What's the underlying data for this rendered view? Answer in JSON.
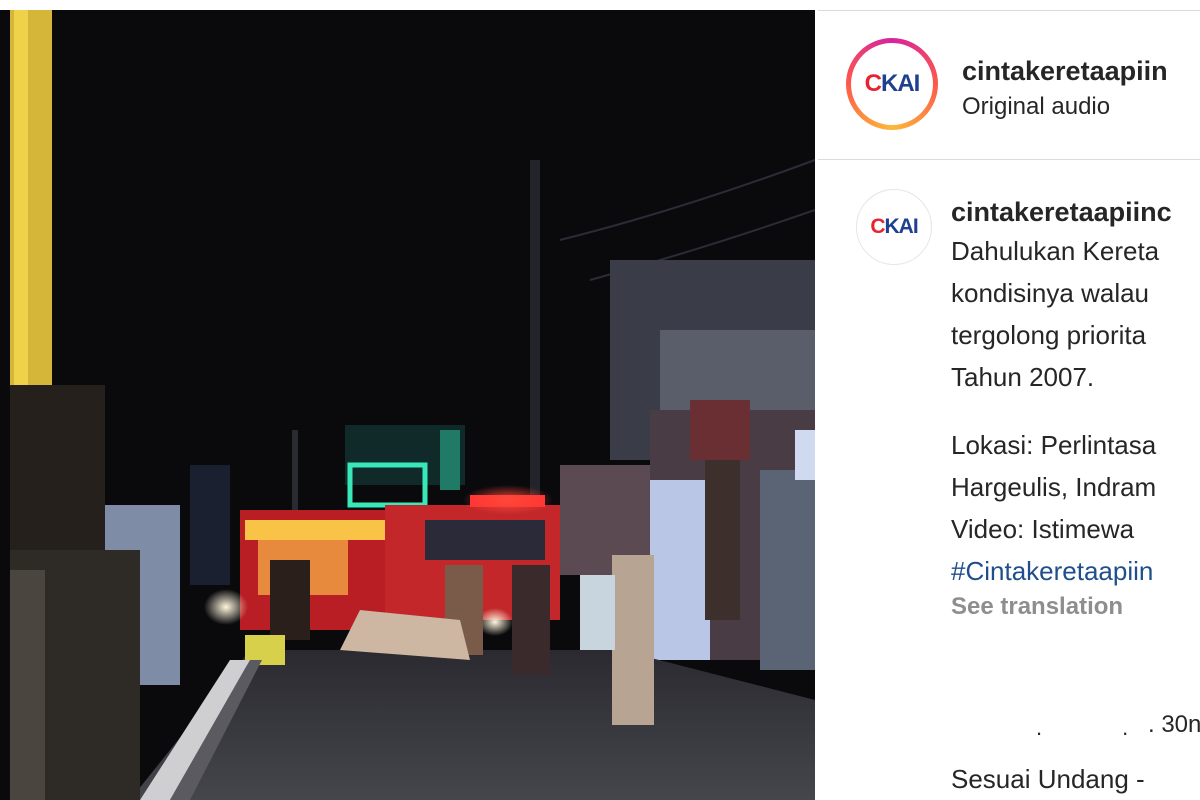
{
  "post": {
    "username": "cintakeretaapiin",
    "audio_label": "Original audio",
    "logo": {
      "c": "C",
      "rest": "KAI"
    }
  },
  "caption": {
    "username": "cintakeretaapiinc",
    "lines": [
      "Dahulukan Kereta",
      "kondisinya walau",
      "tergolong priorita",
      "Tahun 2007."
    ],
    "location_lines": [
      "Lokasi: Perlintasa",
      "Hargeulis, Indram",
      "Video: Istimewa"
    ],
    "hashtag": "#Cintakeretaapiin",
    "see_translation": "See translation"
  },
  "comment": {
    "dots": "..",
    "time": ". 30n",
    "text": "Sesuai Undang -"
  },
  "colors": {
    "brand_red": "#e8232f",
    "brand_blue": "#1f3f8f",
    "hashtag": "#1f4e8c",
    "muted": "#8e8e8e"
  }
}
